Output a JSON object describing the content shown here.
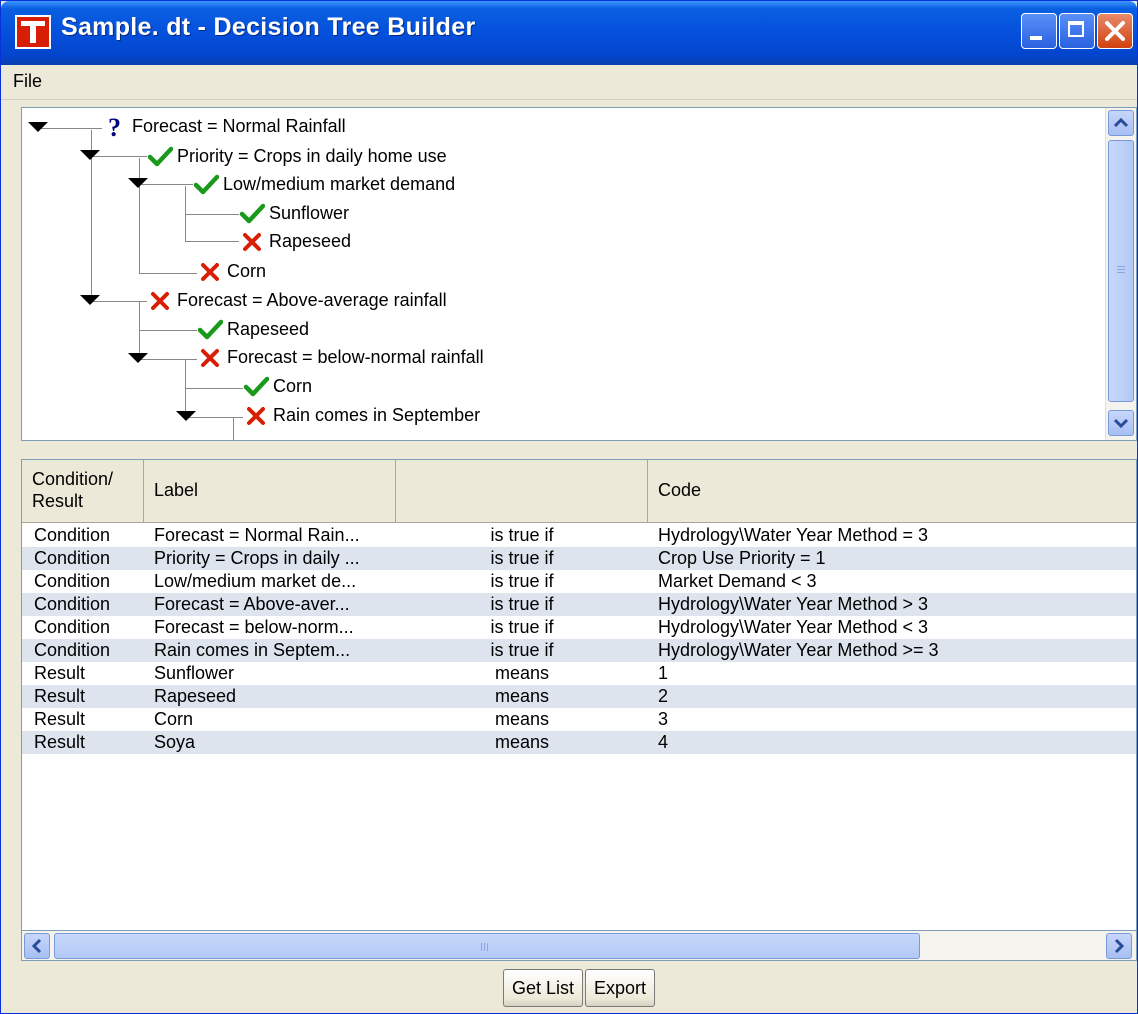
{
  "window": {
    "title": "Sample. dt - Decision Tree Builder"
  },
  "menu": {
    "file": "File"
  },
  "tree": [
    {
      "label": "Forecast = Normal Rainfall",
      "icon": "question-icon"
    },
    {
      "label": "Priority = Crops in daily home use",
      "icon": "check-icon"
    },
    {
      "label": "Low/medium market demand",
      "icon": "check-icon"
    },
    {
      "label": "Sunflower",
      "icon": "check-icon"
    },
    {
      "label": "Rapeseed",
      "icon": "cross-icon"
    },
    {
      "label": "Corn",
      "icon": "cross-icon"
    },
    {
      "label": "Forecast = Above-average rainfall",
      "icon": "cross-icon"
    },
    {
      "label": "Rapeseed",
      "icon": "check-icon"
    },
    {
      "label": "Forecast = below-normal rainfall",
      "icon": "cross-icon"
    },
    {
      "label": "Corn",
      "icon": "check-icon"
    },
    {
      "label": "Rain comes in September",
      "icon": "cross-icon"
    }
  ],
  "table": {
    "headers": {
      "type": "Condition/\nResult",
      "label": "Label",
      "op": "",
      "code": "Code"
    },
    "rows": [
      {
        "type": "Condition",
        "label": "Forecast = Normal Rain...",
        "op": "is true if",
        "code": "Hydrology\\Water Year Method = 3"
      },
      {
        "type": "Condition",
        "label": "Priority = Crops in daily ...",
        "op": "is true if",
        "code": "Crop Use Priority = 1"
      },
      {
        "type": "Condition",
        "label": "Low/medium market de...",
        "op": "is true if",
        "code": "Market Demand < 3"
      },
      {
        "type": "Condition",
        "label": "Forecast = Above-aver...",
        "op": "is true if",
        "code": "Hydrology\\Water Year Method > 3"
      },
      {
        "type": "Condition",
        "label": "Forecast = below-norm...",
        "op": "is true if",
        "code": "Hydrology\\Water Year Method < 3"
      },
      {
        "type": "Condition",
        "label": "Rain comes in Septem...",
        "op": "is true if",
        "code": "Hydrology\\Water Year Method >= 3"
      },
      {
        "type": "Result",
        "label": "Sunflower",
        "op": "means",
        "code": "1"
      },
      {
        "type": "Result",
        "label": "Rapeseed",
        "op": "means",
        "code": "2"
      },
      {
        "type": "Result",
        "label": "Corn",
        "op": "means",
        "code": "3"
      },
      {
        "type": "Result",
        "label": "Soya",
        "op": "means",
        "code": "4"
      }
    ]
  },
  "buttons": {
    "get_list": "Get List",
    "export": "Export"
  },
  "colors": {
    "title_blue": "#0450dc",
    "check": "#1a9a1a",
    "cross": "#d81e05",
    "question": "#000080",
    "alt_row": "#dde4ee"
  }
}
